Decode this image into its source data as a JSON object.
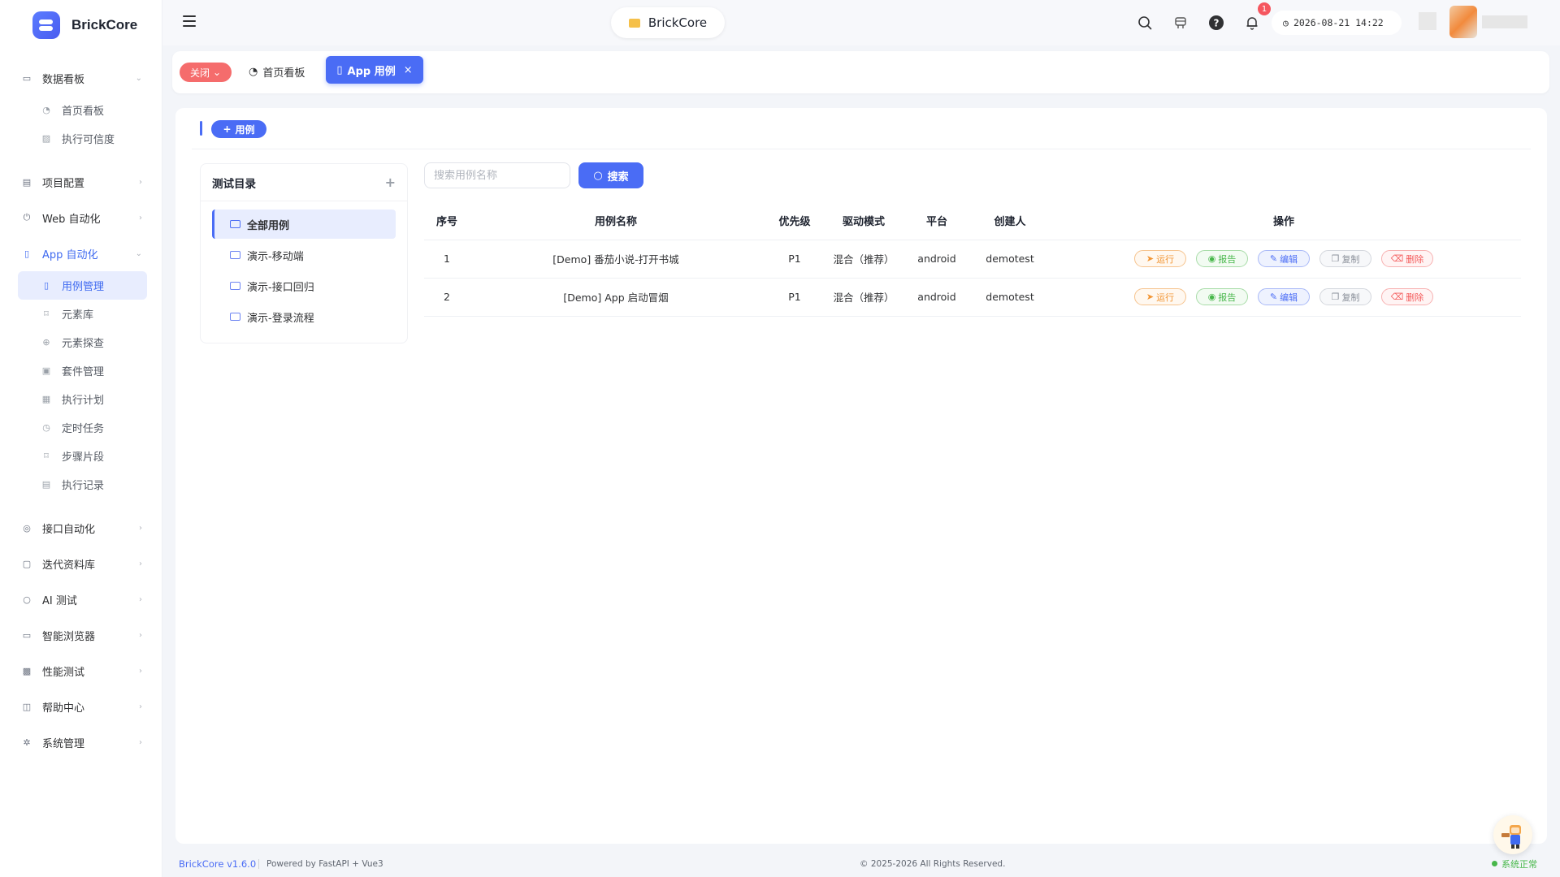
{
  "brand": {
    "name": "BrickCore"
  },
  "sidebar": {
    "groups": [
      {
        "label": "数据看板",
        "icon": "dashboard-icon",
        "children": [
          {
            "label": "首页看板",
            "icon": "gauge-icon"
          },
          {
            "label": "执行可信度",
            "icon": "chart-icon"
          }
        ]
      },
      {
        "label": "项目配置",
        "icon": "project-icon"
      },
      {
        "label": "Web 自动化",
        "icon": "web-icon"
      },
      {
        "label": "App 自动化",
        "icon": "mobile-icon",
        "children": [
          {
            "label": "用例管理",
            "icon": "case-icon"
          },
          {
            "label": "元素库",
            "icon": "bookmark-icon"
          },
          {
            "label": "元素探查",
            "icon": "crosshair-icon"
          },
          {
            "label": "套件管理",
            "icon": "suite-icon"
          },
          {
            "label": "执行计划",
            "icon": "calendar-icon"
          },
          {
            "label": "定时任务",
            "icon": "clock-icon"
          },
          {
            "label": "步骤片段",
            "icon": "bookmark-icon"
          },
          {
            "label": "执行记录",
            "icon": "record-icon"
          }
        ]
      },
      {
        "label": "接口自动化",
        "icon": "api-icon"
      },
      {
        "label": "迭代资料库",
        "icon": "doc-icon"
      },
      {
        "label": "AI 测试",
        "icon": "ai-icon"
      },
      {
        "label": "智能浏览器",
        "icon": "monitor-icon"
      },
      {
        "label": "性能测试",
        "icon": "perf-icon"
      },
      {
        "label": "帮助中心",
        "icon": "book-icon"
      },
      {
        "label": "系统管理",
        "icon": "gear-icon"
      }
    ]
  },
  "header": {
    "project": "BrickCore",
    "notification_count": "1",
    "datetime": "2026-08-21 14:22"
  },
  "tabs": {
    "close_label": "关闭",
    "items": [
      {
        "label": "首页看板"
      },
      {
        "label": "App 用例"
      }
    ]
  },
  "main": {
    "add_case_label": "用例",
    "tree": {
      "title": "测试目录",
      "items": [
        "全部用例",
        "演示-移动端",
        "演示-接口回归",
        "演示-登录流程"
      ]
    },
    "search": {
      "placeholder": "搜索用例名称",
      "button": "搜索"
    },
    "table": {
      "columns": [
        "序号",
        "用例名称",
        "优先级",
        "驱动模式",
        "平台",
        "创建人",
        "操作"
      ],
      "rows": [
        {
          "no": "1",
          "name": "[Demo] 番茄小说-打开书城",
          "priority": "P1",
          "mode": "混合（推荐）",
          "platform": "android",
          "creator": "demotest"
        },
        {
          "no": "2",
          "name": "[Demo] App 启动冒烟",
          "priority": "P1",
          "mode": "混合（推荐）",
          "platform": "android",
          "creator": "demotest"
        }
      ],
      "actions": {
        "run": "运行",
        "report": "报告",
        "edit": "编辑",
        "copy": "复制",
        "delete": "删除"
      }
    }
  },
  "footer": {
    "version": "BrickCore v1.6.0",
    "powered": "Powered by FastAPI + Vue3",
    "copyright": "© 2025-2026 All Rights Reserved.",
    "status": "系统正常"
  },
  "colors": {
    "primary": "#4a6cf5",
    "danger": "#f56c6c",
    "success": "#47b74a",
    "warning": "#f29533"
  }
}
